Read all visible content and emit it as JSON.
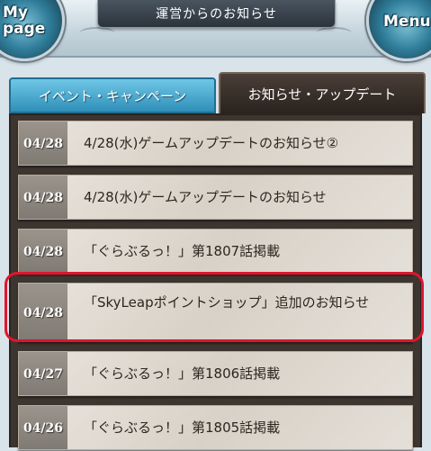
{
  "header": {
    "title": "運営からのお知らせ",
    "mypage_label_line1": "My",
    "mypage_label_line2": "page",
    "menu_label": "Menu"
  },
  "tabs": [
    {
      "label": "イベント・キャンペーン",
      "active": false
    },
    {
      "label": "お知らせ・アップデート",
      "active": true
    }
  ],
  "news": [
    {
      "date": "04/28",
      "title": "4/28(水)ゲームアップデートのお知らせ②"
    },
    {
      "date": "04/28",
      "title": "4/28(水)ゲームアップデートのお知らせ"
    },
    {
      "date": "04/28",
      "title": "「ぐらぶるっ！」第1807話掲載"
    },
    {
      "date": "04/28",
      "title": "「SkyLeapポイントショップ」追加のお知らせ"
    },
    {
      "date": "04/27",
      "title": "「ぐらぶるっ！」第1806話掲載"
    },
    {
      "date": "04/26",
      "title": "「ぐらぶるっ！」第1805話掲載"
    }
  ],
  "colors": {
    "highlight": "#e0152c",
    "active_tab": "#2a221d",
    "inactive_tab": "#2f8fb8"
  }
}
